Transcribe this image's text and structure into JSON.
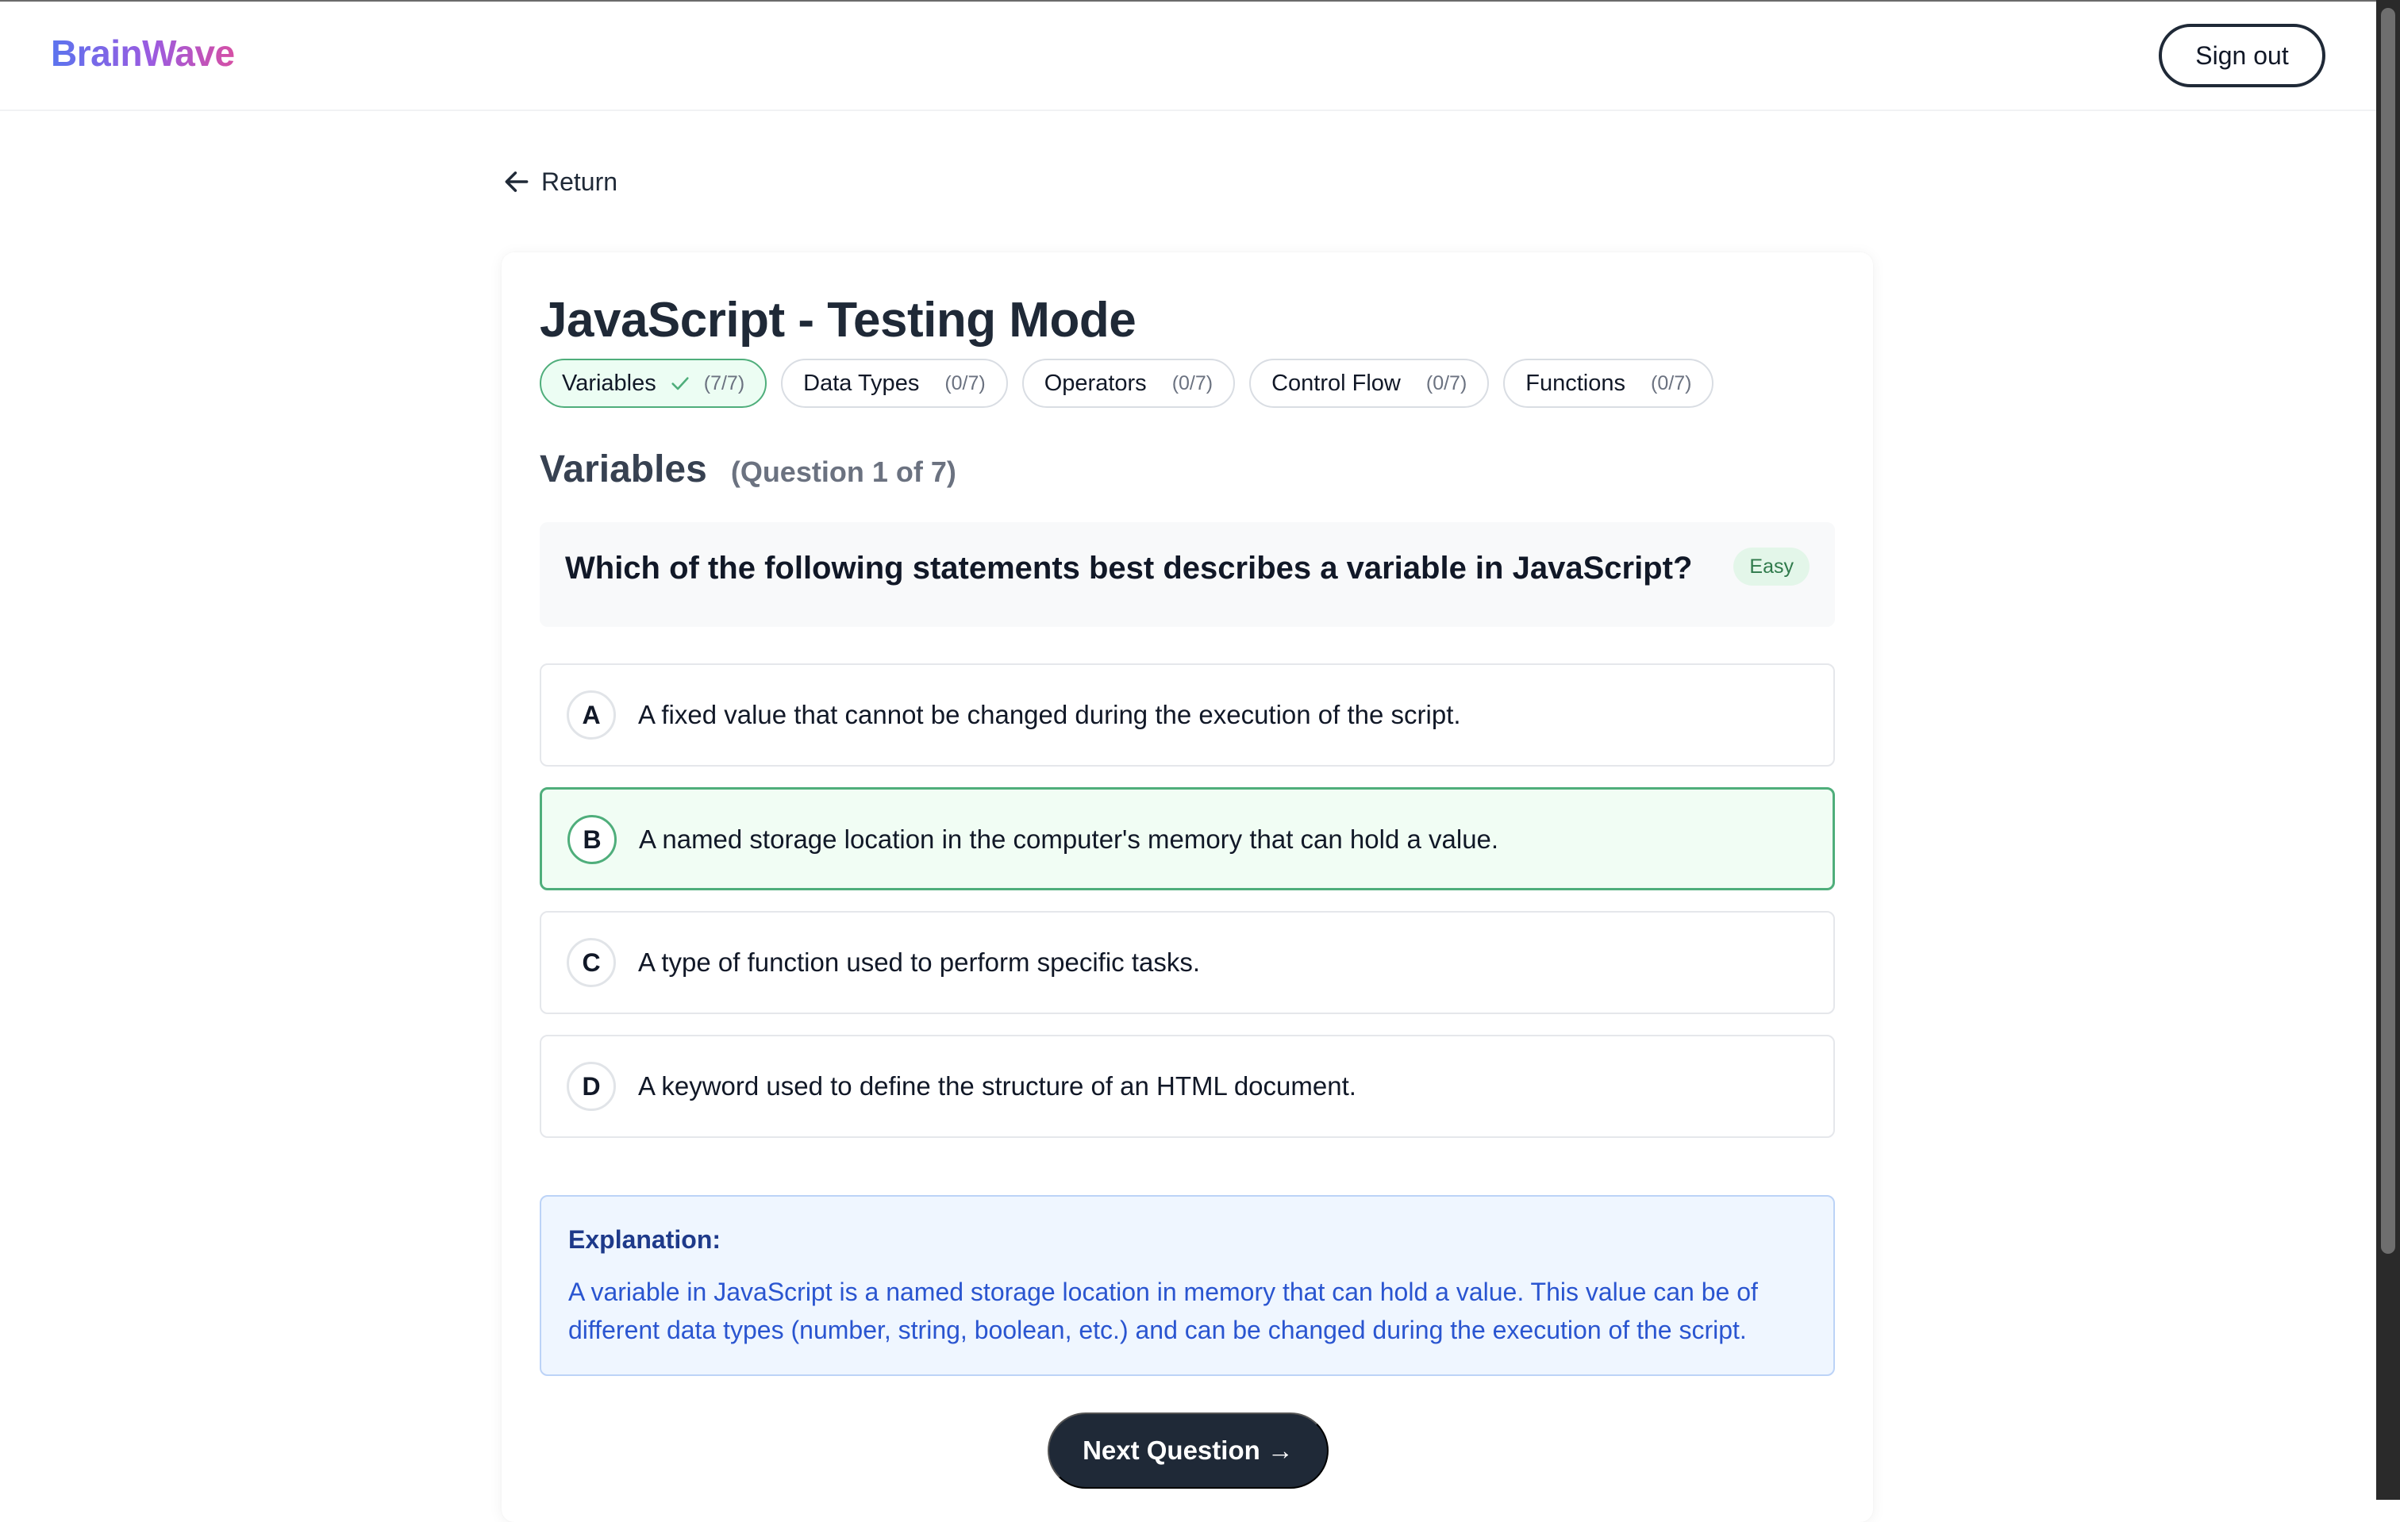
{
  "header": {
    "logo": "BrainWave",
    "signout_label": "Sign out"
  },
  "nav": {
    "return_label": "Return"
  },
  "quiz": {
    "title": "JavaScript - Testing Mode",
    "topics": [
      {
        "label": "Variables",
        "count": "(7/7)",
        "active": true
      },
      {
        "label": "Data Types",
        "count": "(0/7)",
        "active": false
      },
      {
        "label": "Operators",
        "count": "(0/7)",
        "active": false
      },
      {
        "label": "Control Flow",
        "count": "(0/7)",
        "active": false
      },
      {
        "label": "Functions",
        "count": "(0/7)",
        "active": false
      }
    ],
    "section_name": "Variables",
    "section_progress": "(Question 1 of 7)",
    "question": "Which of the following statements best describes a variable in JavaScript?",
    "difficulty": "Easy",
    "options": [
      {
        "letter": "A",
        "text": "A fixed value that cannot be changed during the execution of the script."
      },
      {
        "letter": "B",
        "text": "A named storage location in the computer's memory that can hold a value.",
        "selected": true
      },
      {
        "letter": "C",
        "text": "A type of function used to perform specific tasks."
      },
      {
        "letter": "D",
        "text": "A keyword used to define the structure of an HTML document."
      }
    ],
    "explanation_title": "Explanation:",
    "explanation_body": "A variable in JavaScript is a named storage location in memory that can hold a value. This value can be of different data types (number, string, boolean, etc.) and can be changed during the execution of the script.",
    "next_label": "Next Question →"
  },
  "colors": {
    "accent_green": "#4fae7b",
    "explanation_blue": "#2a55d0",
    "dark_button": "#1f2937"
  },
  "icons": {
    "return": "arrow-left-icon",
    "topic_complete": "check-icon"
  }
}
